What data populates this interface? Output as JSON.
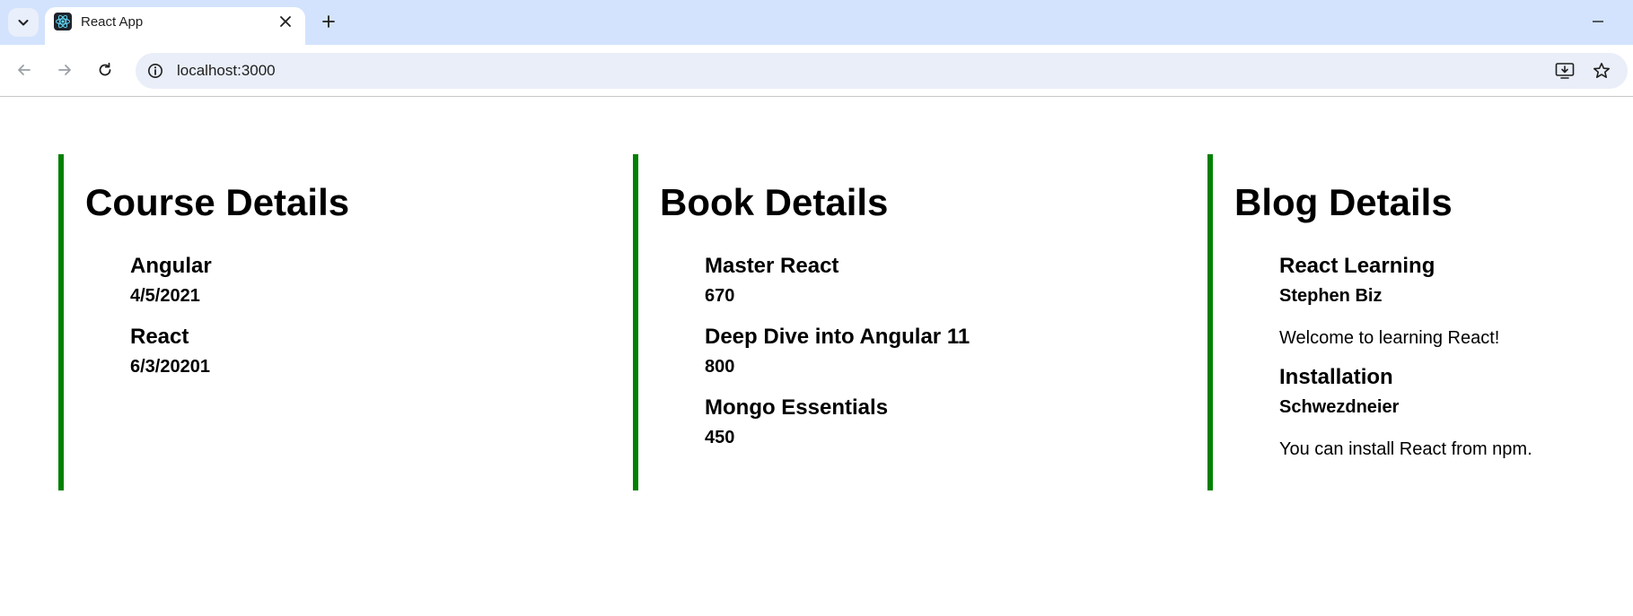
{
  "browser": {
    "tab_title": "React App",
    "url": "localhost:3000"
  },
  "icons": {
    "tab_search": "chevron-down-icon",
    "favicon": "react-logo-icon",
    "tab_close": "close-icon",
    "new_tab": "plus-icon",
    "minimize": "minimize-icon",
    "back": "arrow-left-icon",
    "forward": "arrow-right-icon",
    "reload": "reload-icon",
    "site_info": "info-icon",
    "install": "install-app-icon",
    "bookmark": "star-icon"
  },
  "colors": {
    "accent_border": "#008000",
    "tabbar_bg": "#d3e3fd",
    "react_logo": "#61dafb"
  },
  "courses": {
    "heading": "Course Details",
    "items": [
      {
        "name": "Angular",
        "date": "4/5/2021"
      },
      {
        "name": "React",
        "date": "6/3/20201"
      }
    ]
  },
  "books": {
    "heading": "Book Details",
    "items": [
      {
        "name": "Master React",
        "price": "670"
      },
      {
        "name": "Deep Dive into Angular 11",
        "price": "800"
      },
      {
        "name": "Mongo Essentials",
        "price": "450"
      }
    ]
  },
  "blogs": {
    "heading": "Blog Details",
    "items": [
      {
        "title": "React Learning",
        "author": "Stephen Biz",
        "content": "Welcome to learning React!"
      },
      {
        "title": "Installation",
        "author": "Schwezdneier",
        "content": "You can install React from npm."
      }
    ]
  }
}
